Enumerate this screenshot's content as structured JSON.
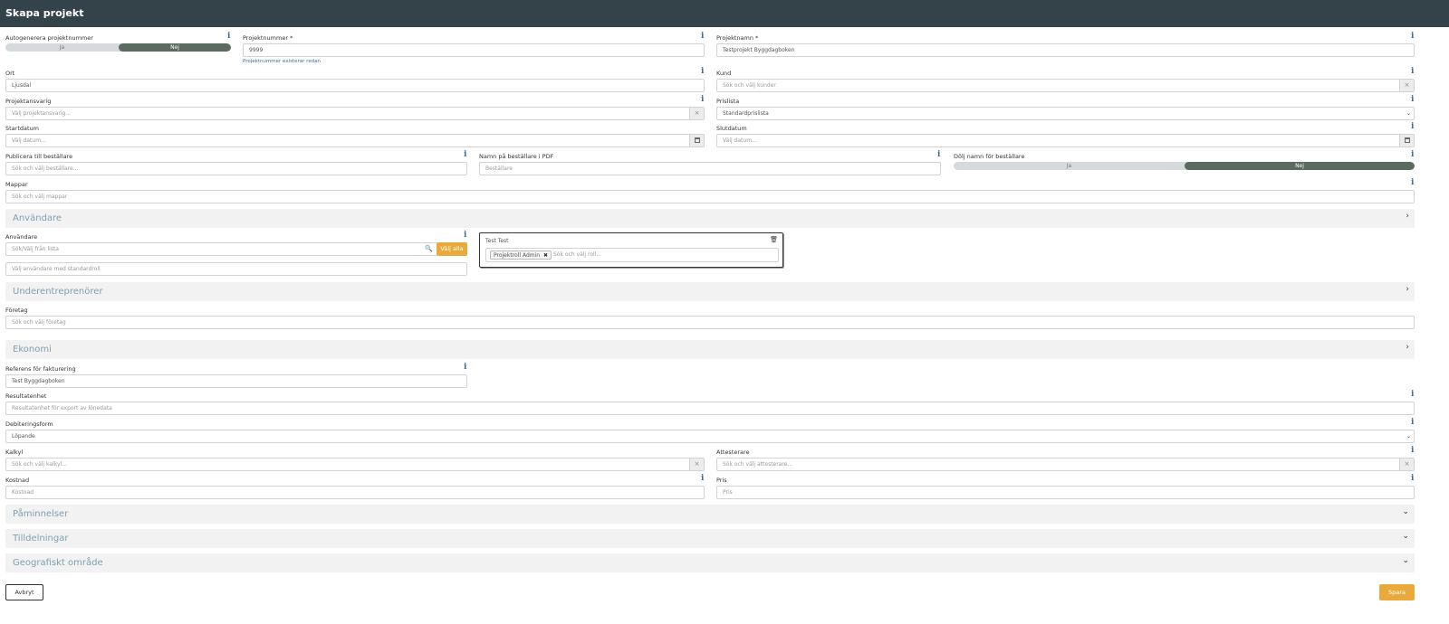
{
  "header": {
    "title": "Skapa projekt"
  },
  "form": {
    "autogen": {
      "label": "Autogenerera projektnummer",
      "yes": "Ja",
      "no": "Nej"
    },
    "projektnummer": {
      "label": "Projektnummer *",
      "value": "9999",
      "help": "Projektnummer existerar redan"
    },
    "projektnamn": {
      "label": "Projektnamn *",
      "value": "Testprojekt Byggdagboken"
    },
    "ort": {
      "label": "Ort",
      "value": "Ljusdal"
    },
    "kund": {
      "label": "Kund",
      "placeholder": "Sök och välj kunder"
    },
    "projektansvarig": {
      "label": "Projektansvarig",
      "placeholder": "Välj projektansvarig..."
    },
    "prislista": {
      "label": "Prislista",
      "value": "Standardprislista"
    },
    "startdatum": {
      "label": "Startdatum",
      "placeholder": "Välj datum..."
    },
    "slutdatum": {
      "label": "Slutdatum",
      "placeholder": "Välj datum..."
    },
    "publicera": {
      "label": "Publicera till beställare",
      "placeholder": "Sök och välj beställare..."
    },
    "namn_pdf": {
      "label": "Namn på beställare i PDF",
      "placeholder": "Beställare"
    },
    "dolj_namn": {
      "label": "Dölj namn för beställare",
      "yes": "Ja",
      "no": "Nej"
    },
    "mappar": {
      "label": "Mappar",
      "placeholder": "Sök och välj mappar"
    }
  },
  "sections": {
    "anvandare": "Användare",
    "underentreprenorer": "Underentreprenörer",
    "ekonomi": "Ekonomi",
    "paminnelser": "Påminnelser",
    "tilldelningar": "Tilldelningar",
    "geografiskt": "Geografiskt område"
  },
  "users": {
    "label": "Användare",
    "search_placeholder": "Sök/Välj från lista",
    "select_all": "Välj alla",
    "standard_role_placeholder": "Välj användare med standardroll",
    "card_name": "Test Test",
    "role_tag": "Projektroll Admin",
    "role_placeholder": "Sök och välj roll..."
  },
  "sub": {
    "label": "Företag",
    "placeholder": "Sök och välj företag"
  },
  "economy": {
    "referens": {
      "label": "Referens för fakturering",
      "value": "Test Byggdagboken"
    },
    "resultatenhet": {
      "label": "Resultatenhet",
      "placeholder": "Resultatenhet för export av lönedata"
    },
    "debitering": {
      "label": "Debiteringsform",
      "value": "Löpande"
    },
    "kalkyl": {
      "label": "Kalkyl",
      "placeholder": "Sök och välj kalkyl..."
    },
    "attesterare": {
      "label": "Attesterare",
      "placeholder": "Sök och välj attesterare..."
    },
    "kostnad": {
      "label": "Kostnad",
      "placeholder": "Kostnad"
    },
    "pris": {
      "label": "Pris",
      "placeholder": "Pris"
    }
  },
  "footer": {
    "cancel": "Avbryt",
    "save": "Spara"
  },
  "icons": {
    "info": "i",
    "clear": "×",
    "caret": "⌄",
    "chevron_right": "›",
    "chevron_down": "⌄",
    "search": "🔍",
    "trash": "🗑",
    "remove": "✖"
  }
}
